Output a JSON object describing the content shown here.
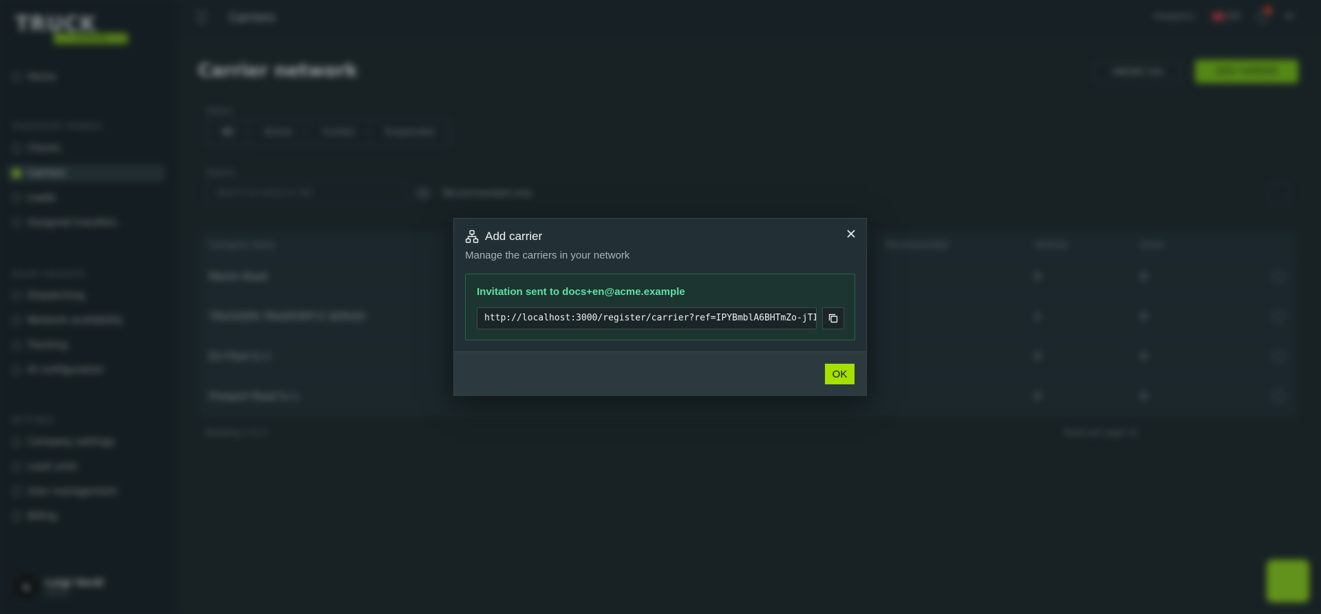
{
  "app": {
    "logo_text": "TRUCK",
    "logo_tag": "PLATFORM",
    "topbar_title": "Carriers",
    "topbar_right": [
      "Analytics",
      "EN"
    ],
    "sidebar": {
      "home": "Home",
      "section_1": "TRANSPORT PANNER",
      "items_1": [
        "Clients",
        "Carriers",
        "Loads",
        "Assigned transfers"
      ],
      "section_2": "SMART INSIGHTS",
      "items_2": [
        "Dispatching",
        "Network availability",
        "Tracking",
        "AI configuration"
      ],
      "section_3": "SETTINGS",
      "items_3": [
        "Company settings",
        "Load units",
        "User management",
        "Billing"
      ],
      "user_initial": "N",
      "user_name": "Luigi Verdi",
      "user_role": "Admin"
    },
    "page_title": "Carrier network",
    "import_button": "IMPORT CSV",
    "add_button": "ADD CARRIER",
    "status_label": "Status",
    "status_options": [
      "All",
      "Active",
      "Invited",
      "Suspended"
    ],
    "search_label": "Search",
    "search_placeholder": "Search by name or VAT",
    "recommended_label": "Recommended only",
    "columns": [
      "Company name",
      "Recommended",
      "Vehicles",
      "Score"
    ],
    "rows": [
      {
        "name": "Martin Road",
        "vehicles": "0",
        "score": "0"
      },
      {
        "name": "TRUCKSPA TRASPORTI E SERVIZI",
        "vehicles": "1",
        "score": "0"
      },
      {
        "name": "EU Fleet S.r.l.",
        "vehicles": "0",
        "score": "0"
      },
      {
        "name": "Freeport Road S.r.l.",
        "vehicles": "0",
        "score": "0"
      }
    ],
    "pager_left": "Showing 1 to 4",
    "pager_right": "Rows per page 10"
  },
  "modal": {
    "title": "Add carrier",
    "subtitle": "Manage the carriers in your network",
    "notice": "Invitation sent to docs+en@acme.example",
    "invite_url": "http://localhost:3000/register/carrier?ref=IPYBmblA6BHTmZo-jTI",
    "ok_label": "OK"
  }
}
